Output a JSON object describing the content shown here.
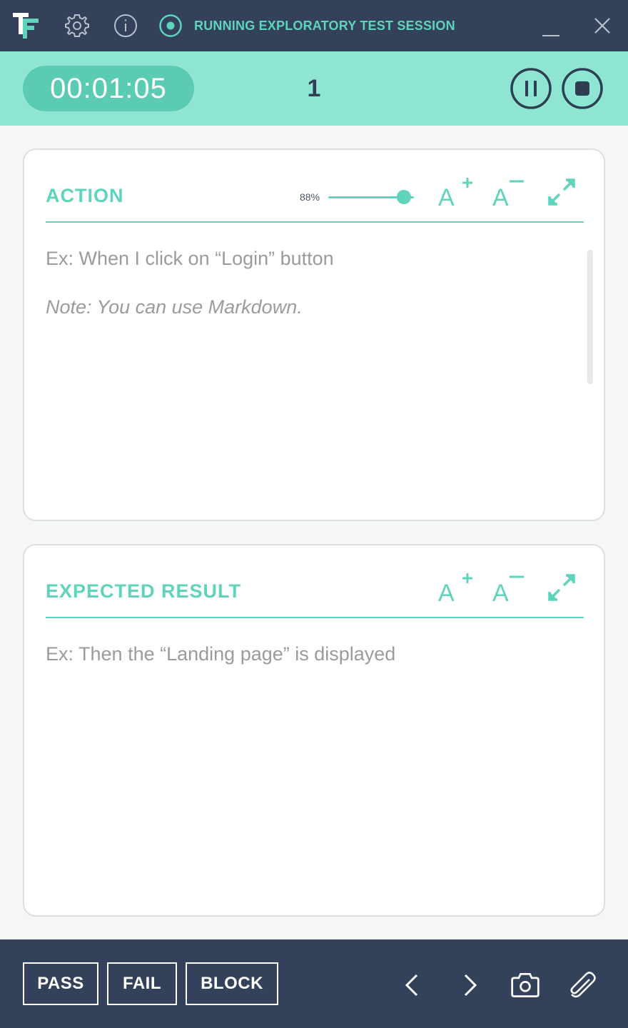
{
  "titlebar": {
    "session_title": "RUNNING EXPLORATORY TEST SESSION",
    "icons": [
      "tf-logo-icon",
      "gear-icon",
      "info-icon",
      "record-icon",
      "minimize-icon",
      "close-icon"
    ]
  },
  "timerbar": {
    "timer": "00:01:05",
    "step_number": "1",
    "controls": [
      "pause-icon",
      "stop-icon"
    ]
  },
  "action": {
    "title": "ACTION",
    "zoom_label": "88%",
    "zoom_level": 0.88,
    "placeholder_line1": "Ex: When I click on “Login” button",
    "placeholder_line2": "Note: You can use Markdown.",
    "tools": [
      "font-increase-icon",
      "font-decrease-icon",
      "expand-icon"
    ]
  },
  "expected": {
    "title": "EXPECTED RESULT",
    "placeholder_line1": "Ex: Then the “Landing page” is displayed",
    "tools": [
      "font-increase-icon",
      "font-decrease-icon",
      "expand-icon"
    ]
  },
  "bottombar": {
    "pass_label": "PASS",
    "fail_label": "FAIL",
    "block_label": "BLOCK",
    "icons": [
      "chevron-left-icon",
      "chevron-right-icon",
      "camera-icon",
      "paperclip-icon"
    ]
  },
  "colors": {
    "dark": "#33425a",
    "accent": "#5fd3bc",
    "timer_bg": "#8ee5d2",
    "timer_pill": "#5ccbb3",
    "placeholder": "#9b9b9b"
  }
}
